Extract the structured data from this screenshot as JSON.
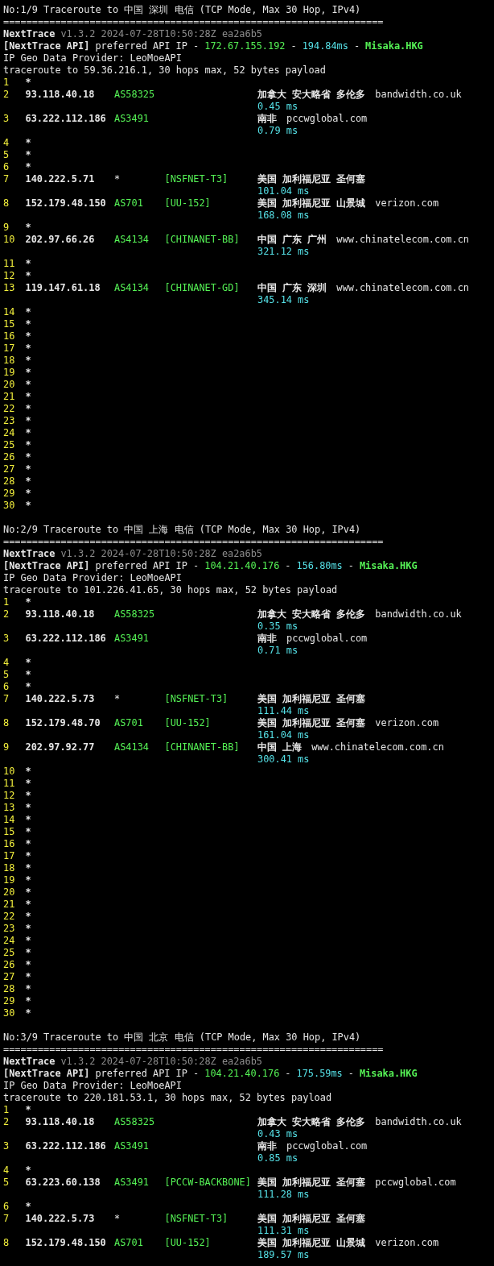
{
  "sections": [
    {
      "title": "No:1/9 Traceroute to 中国 深圳 电信 (TCP Mode, Max 30 Hop, IPv4)",
      "separator": "==================================================================",
      "header": {
        "name": "NextTrace",
        "version": "v1.3.2 2024-07-28T10:50:28Z ea2a6b5",
        "api_label": "[NextTrace API]",
        "api_text": "preferred API IP -",
        "api_ip": "172.67.155.192",
        "dash_1": "-",
        "api_ms": "194.84ms",
        "dash_2": "-",
        "api_node": "Misaka.HKG",
        "provider": "IP Geo Data Provider: LeoMoeAPI",
        "traceroute": "traceroute to 59.36.216.1, 30 hops max, 52 bytes payload"
      },
      "hops": [
        {
          "kind": "timeout",
          "hop": "1",
          "ip": "*"
        },
        {
          "kind": "reply",
          "hop": "2",
          "ip": "93.118.40.18",
          "asn": "AS58325",
          "geo": "加拿大 安大略省 多伦多",
          "domain": "bandwidth.co.uk",
          "ms": "0.45 ms"
        },
        {
          "kind": "reply",
          "hop": "3",
          "ip": "63.222.112.186",
          "asn": "AS3491",
          "geo": "南非",
          "domain": "pccwglobal.com",
          "ms": "0.79 ms"
        },
        {
          "kind": "timeout",
          "hop": "4",
          "ip": "*"
        },
        {
          "kind": "timeout",
          "hop": "5",
          "ip": "*"
        },
        {
          "kind": "timeout",
          "hop": "6",
          "ip": "*"
        },
        {
          "kind": "reply",
          "hop": "7",
          "ip": "140.222.5.71",
          "asn": "*",
          "tag": "[NSFNET-T3]",
          "geo": "美国 加利福尼亚 圣何塞",
          "ms": "101.04 ms"
        },
        {
          "kind": "reply",
          "hop": "8",
          "ip": "152.179.48.150",
          "asn": "AS701",
          "tag": "[UU-152]",
          "geo": "美国 加利福尼亚 山景城",
          "domain": "verizon.com",
          "ms": "168.08 ms"
        },
        {
          "kind": "timeout",
          "hop": "9",
          "ip": "*"
        },
        {
          "kind": "reply",
          "hop": "10",
          "ip": "202.97.66.26",
          "asn": "AS4134",
          "tag": "[CHINANET-BB]",
          "geo": "中国 广东 广州",
          "domain": "www.chinatelecom.com.cn",
          "ms": "321.12 ms"
        },
        {
          "kind": "timeout",
          "hop": "11",
          "ip": "*"
        },
        {
          "kind": "timeout",
          "hop": "12",
          "ip": "*"
        },
        {
          "kind": "reply",
          "hop": "13",
          "ip": "119.147.61.18",
          "asn": "AS4134",
          "tag": "[CHINANET-GD]",
          "geo": "中国 广东 深圳",
          "domain": "www.chinatelecom.com.cn",
          "ms": "345.14 ms"
        },
        {
          "kind": "timeout",
          "hop": "14",
          "ip": "*"
        },
        {
          "kind": "timeout",
          "hop": "15",
          "ip": "*"
        },
        {
          "kind": "timeout",
          "hop": "16",
          "ip": "*"
        },
        {
          "kind": "timeout",
          "hop": "17",
          "ip": "*"
        },
        {
          "kind": "timeout",
          "hop": "18",
          "ip": "*"
        },
        {
          "kind": "timeout",
          "hop": "19",
          "ip": "*"
        },
        {
          "kind": "timeout",
          "hop": "20",
          "ip": "*"
        },
        {
          "kind": "timeout",
          "hop": "21",
          "ip": "*"
        },
        {
          "kind": "timeout",
          "hop": "22",
          "ip": "*"
        },
        {
          "kind": "timeout",
          "hop": "23",
          "ip": "*"
        },
        {
          "kind": "timeout",
          "hop": "24",
          "ip": "*"
        },
        {
          "kind": "timeout",
          "hop": "25",
          "ip": "*"
        },
        {
          "kind": "timeout",
          "hop": "26",
          "ip": "*"
        },
        {
          "kind": "timeout",
          "hop": "27",
          "ip": "*"
        },
        {
          "kind": "timeout",
          "hop": "28",
          "ip": "*"
        },
        {
          "kind": "timeout",
          "hop": "29",
          "ip": "*"
        },
        {
          "kind": "timeout",
          "hop": "30",
          "ip": "*"
        }
      ]
    },
    {
      "title": "No:2/9 Traceroute to 中国 上海 电信 (TCP Mode, Max 30 Hop, IPv4)",
      "separator": "==================================================================",
      "header": {
        "name": "NextTrace",
        "version": "v1.3.2 2024-07-28T10:50:28Z ea2a6b5",
        "api_label": "[NextTrace API]",
        "api_text": "preferred API IP -",
        "api_ip": "104.21.40.176",
        "dash_1": "-",
        "api_ms": "156.80ms",
        "dash_2": "-",
        "api_node": "Misaka.HKG",
        "provider": "IP Geo Data Provider: LeoMoeAPI",
        "traceroute": "traceroute to 101.226.41.65, 30 hops max, 52 bytes payload"
      },
      "hops": [
        {
          "kind": "timeout",
          "hop": "1",
          "ip": "*"
        },
        {
          "kind": "reply",
          "hop": "2",
          "ip": "93.118.40.18",
          "asn": "AS58325",
          "geo": "加拿大 安大略省 多伦多",
          "domain": "bandwidth.co.uk",
          "ms": "0.35 ms"
        },
        {
          "kind": "reply",
          "hop": "3",
          "ip": "63.222.112.186",
          "asn": "AS3491",
          "geo": "南非",
          "domain": "pccwglobal.com",
          "ms": "0.71 ms"
        },
        {
          "kind": "timeout",
          "hop": "4",
          "ip": "*"
        },
        {
          "kind": "timeout",
          "hop": "5",
          "ip": "*"
        },
        {
          "kind": "timeout",
          "hop": "6",
          "ip": "*"
        },
        {
          "kind": "reply",
          "hop": "7",
          "ip": "140.222.5.73",
          "asn": "*",
          "tag": "[NSFNET-T3]",
          "geo": "美国 加利福尼亚 圣何塞",
          "ms": "111.44 ms"
        },
        {
          "kind": "reply",
          "hop": "8",
          "ip": "152.179.48.70",
          "asn": "AS701",
          "tag": "[UU-152]",
          "geo": "美国 加利福尼亚 圣何塞",
          "domain": "verizon.com",
          "ms": "161.04 ms"
        },
        {
          "kind": "reply",
          "hop": "9",
          "ip": "202.97.92.77",
          "asn": "AS4134",
          "tag": "[CHINANET-BB]",
          "geo": "中国 上海",
          "domain": "www.chinatelecom.com.cn",
          "ms": "300.41 ms"
        },
        {
          "kind": "timeout",
          "hop": "10",
          "ip": "*"
        },
        {
          "kind": "timeout",
          "hop": "11",
          "ip": "*"
        },
        {
          "kind": "timeout",
          "hop": "12",
          "ip": "*"
        },
        {
          "kind": "timeout",
          "hop": "13",
          "ip": "*"
        },
        {
          "kind": "timeout",
          "hop": "14",
          "ip": "*"
        },
        {
          "kind": "timeout",
          "hop": "15",
          "ip": "*"
        },
        {
          "kind": "timeout",
          "hop": "16",
          "ip": "*"
        },
        {
          "kind": "timeout",
          "hop": "17",
          "ip": "*"
        },
        {
          "kind": "timeout",
          "hop": "18",
          "ip": "*"
        },
        {
          "kind": "timeout",
          "hop": "19",
          "ip": "*"
        },
        {
          "kind": "timeout",
          "hop": "20",
          "ip": "*"
        },
        {
          "kind": "timeout",
          "hop": "21",
          "ip": "*"
        },
        {
          "kind": "timeout",
          "hop": "22",
          "ip": "*"
        },
        {
          "kind": "timeout",
          "hop": "23",
          "ip": "*"
        },
        {
          "kind": "timeout",
          "hop": "24",
          "ip": "*"
        },
        {
          "kind": "timeout",
          "hop": "25",
          "ip": "*"
        },
        {
          "kind": "timeout",
          "hop": "26",
          "ip": "*"
        },
        {
          "kind": "timeout",
          "hop": "27",
          "ip": "*"
        },
        {
          "kind": "timeout",
          "hop": "28",
          "ip": "*"
        },
        {
          "kind": "timeout",
          "hop": "29",
          "ip": "*"
        },
        {
          "kind": "timeout",
          "hop": "30",
          "ip": "*"
        }
      ]
    },
    {
      "title": "No:3/9 Traceroute to 中国 北京 电信 (TCP Mode, Max 30 Hop, IPv4)",
      "separator": "==================================================================",
      "header": {
        "name": "NextTrace",
        "version": "v1.3.2 2024-07-28T10:50:28Z ea2a6b5",
        "api_label": "[NextTrace API]",
        "api_text": "preferred API IP -",
        "api_ip": "104.21.40.176",
        "dash_1": "-",
        "api_ms": "175.59ms",
        "dash_2": "-",
        "api_node": "Misaka.HKG",
        "provider": "IP Geo Data Provider: LeoMoeAPI",
        "traceroute": "traceroute to 220.181.53.1, 30 hops max, 52 bytes payload"
      },
      "hops": [
        {
          "kind": "timeout",
          "hop": "1",
          "ip": "*"
        },
        {
          "kind": "reply",
          "hop": "2",
          "ip": "93.118.40.18",
          "asn": "AS58325",
          "geo": "加拿大 安大略省 多伦多",
          "domain": "bandwidth.co.uk",
          "ms": "0.43 ms"
        },
        {
          "kind": "reply",
          "hop": "3",
          "ip": "63.222.112.186",
          "asn": "AS3491",
          "geo": "南非",
          "domain": "pccwglobal.com",
          "ms": "0.85 ms"
        },
        {
          "kind": "timeout",
          "hop": "4",
          "ip": "*"
        },
        {
          "kind": "reply",
          "hop": "5",
          "ip": "63.223.60.138",
          "asn": "AS3491",
          "tag": "[PCCW-BACKBONE]",
          "geo": "美国 加利福尼亚 圣何塞",
          "domain": "pccwglobal.com",
          "ms": "111.28 ms"
        },
        {
          "kind": "timeout",
          "hop": "6",
          "ip": "*"
        },
        {
          "kind": "reply",
          "hop": "7",
          "ip": "140.222.5.73",
          "asn": "*",
          "tag": "[NSFNET-T3]",
          "geo": "美国 加利福尼亚 圣何塞",
          "ms": "111.31 ms"
        },
        {
          "kind": "reply",
          "hop": "8",
          "ip": "152.179.48.150",
          "asn": "AS701",
          "tag": "[UU-152]",
          "geo": "美国 加利福尼亚 山景城",
          "domain": "verizon.com",
          "ms": "189.57 ms"
        }
      ]
    }
  ]
}
